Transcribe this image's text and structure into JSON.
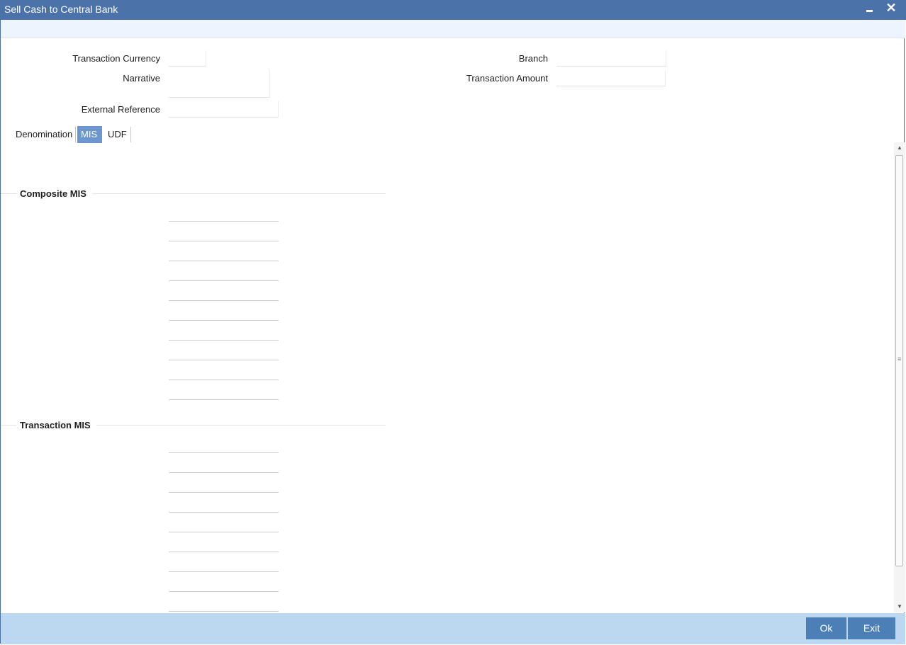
{
  "window": {
    "title": "Sell Cash to Central Bank",
    "minimize_icon": "minimize-icon",
    "close_icon": "close-icon",
    "close_glyph": "✕"
  },
  "form": {
    "transaction_currency_label": "Transaction Currency",
    "transaction_currency_value": "",
    "narrative_label": "Narrative",
    "narrative_value": "",
    "external_reference_label": "External Reference",
    "external_reference_value": "",
    "branch_label": "Branch",
    "branch_value": "",
    "transaction_amount_label": "Transaction Amount",
    "transaction_amount_value": ""
  },
  "tabs": [
    {
      "label": "Denomination",
      "active": false
    },
    {
      "label": "MIS",
      "active": true
    },
    {
      "label": "UDF",
      "active": false
    }
  ],
  "mis": {
    "composite_title": "Composite MIS",
    "composite_fields": [
      "",
      "",
      "",
      "",
      "",
      "",
      "",
      "",
      "",
      ""
    ],
    "transaction_title": "Transaction MIS",
    "transaction_fields": [
      "",
      "",
      "",
      "",
      "",
      "",
      "",
      "",
      ""
    ]
  },
  "scrollbar": {
    "up_icon": "scroll-up-icon",
    "down_icon": "scroll-down-icon",
    "up_glyph": "▲",
    "down_glyph": "▼"
  },
  "footer": {
    "ok_label": "Ok",
    "exit_label": "Exit"
  },
  "colors": {
    "titlebar": "#4c72aa",
    "active_tab": "#6b96cf",
    "footer": "#bcd7f0",
    "button": "#4c7fb6"
  }
}
